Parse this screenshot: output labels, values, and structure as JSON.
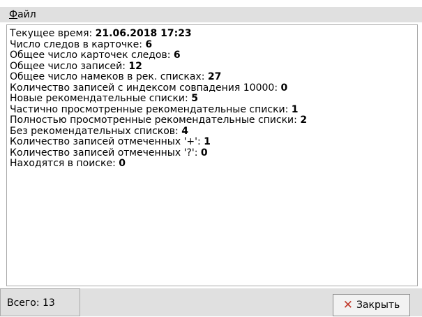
{
  "menu": {
    "file_label_first": "Ф",
    "file_label_rest": "айл"
  },
  "stats": [
    {
      "label": "Текущее время: ",
      "value": "21.06.2018 17:23"
    },
    {
      "label": "Число следов в карточке: ",
      "value": "6"
    },
    {
      "label": "Общее число карточек следов: ",
      "value": "6"
    },
    {
      "label": "Общее число записей: ",
      "value": "12"
    },
    {
      "label": "Общее число намеков в рек. списках: ",
      "value": "27"
    },
    {
      "label": "Количество записей с индексом совпадения 10000: ",
      "value": "0"
    },
    {
      "label": "Новые рекомендательные списки: ",
      "value": "5"
    },
    {
      "label": "Частично просмотренные рекомендательные списки: ",
      "value": "1"
    },
    {
      "label": "Полностью просмотренные рекомендательные списки: ",
      "value": "2"
    },
    {
      "label": "Без рекомендательных списков: ",
      "value": "4"
    },
    {
      "label": "Количество записей отмеченных '+': ",
      "value": "1"
    },
    {
      "label": "Количество записей отмеченных '?': ",
      "value": "0"
    },
    {
      "label": "Находятся в поиске: ",
      "value": "0"
    }
  ],
  "status": {
    "total": "Всего: 13"
  },
  "close_button": {
    "label": "Закрыть",
    "icon": "close-icon"
  },
  "colors": {
    "close_icon": "#c0392b"
  }
}
